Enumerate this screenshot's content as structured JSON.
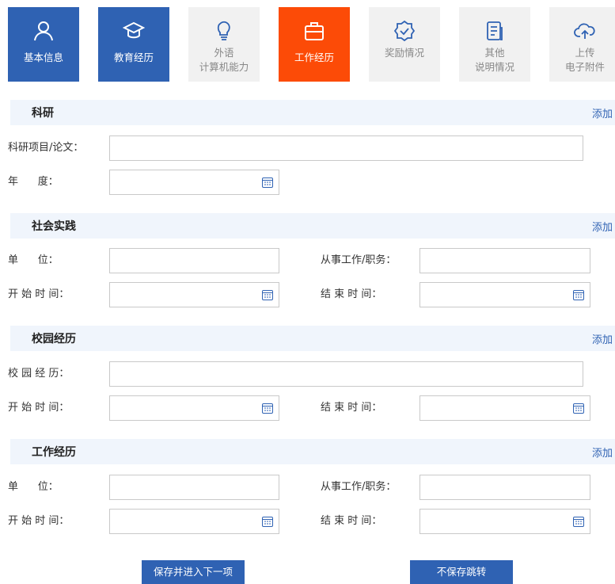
{
  "tabs": [
    {
      "label": "基本信息",
      "icon": "user-icon",
      "state": "completed"
    },
    {
      "label": "教育经历",
      "icon": "graduation-cap-icon",
      "state": "completed"
    },
    {
      "label": "外语",
      "label2": "计算机能力",
      "icon": "lightbulb-icon",
      "state": "inactive"
    },
    {
      "label": "工作经历",
      "icon": "briefcase-icon",
      "state": "active"
    },
    {
      "label": "奖励情况",
      "icon": "award-icon",
      "state": "inactive"
    },
    {
      "label": "其他",
      "label2": "说明情况",
      "icon": "document-icon",
      "state": "inactive"
    },
    {
      "label": "上传",
      "label2": "电子附件",
      "icon": "cloud-upload-icon",
      "state": "inactive"
    }
  ],
  "colors": {
    "completed_tab": "#2f62b3",
    "active_tab": "#fc4b07",
    "inactive_tab": "#f1f1f1",
    "section_bg": "#f0f5fc",
    "link": "#2f62b3"
  },
  "sections": {
    "research": {
      "title": "科研",
      "add_label": "添加",
      "project_label": "科研项目/论文：",
      "year_label": "年      度："
    },
    "social": {
      "title": "社会实践",
      "add_label": "添加",
      "unit_label": "单      位：",
      "position_label": "从事工作/职务：",
      "start_label": "开 始 时 间：",
      "end_label": "结 束 时 间："
    },
    "campus": {
      "title": "校园经历",
      "add_label": "添加",
      "experience_label": "校 园 经 历：",
      "start_label": "开 始 时 间：",
      "end_label": "结 束 时 间："
    },
    "work": {
      "title": "工作经历",
      "add_label": "添加",
      "unit_label": "单      位：",
      "position_label": "从事工作/职务：",
      "start_label": "开 始 时 间：",
      "end_label": "结 束 时 间："
    }
  },
  "buttons": {
    "save_next": "保存并进入下一项",
    "skip": "不保存跳转"
  }
}
